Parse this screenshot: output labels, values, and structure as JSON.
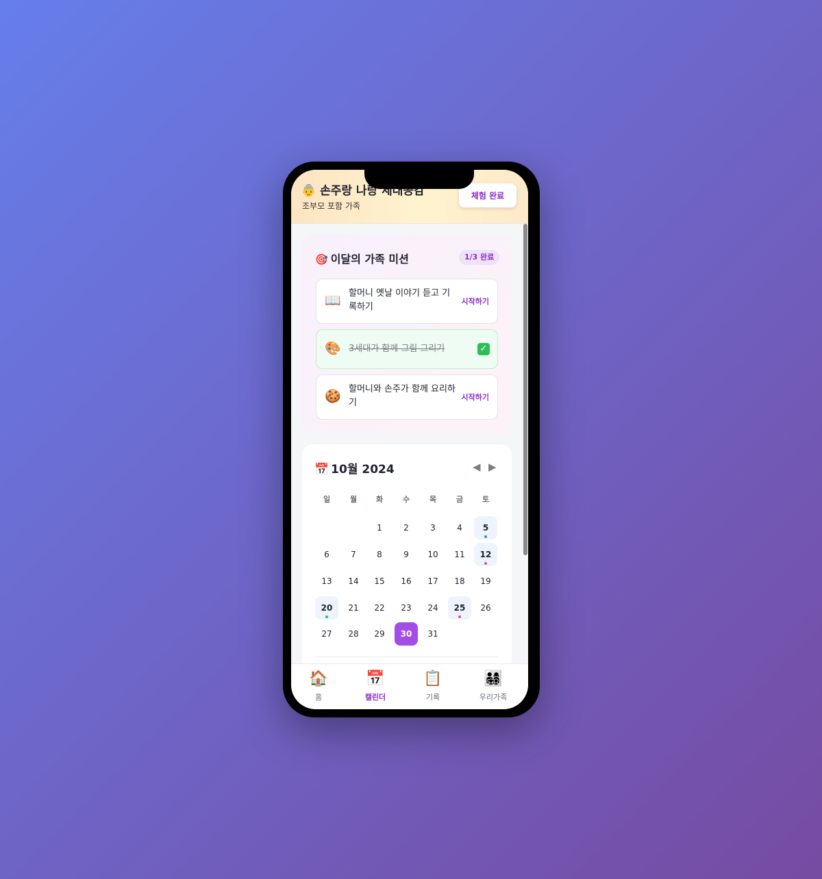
{
  "header": {
    "icon": "👵",
    "title": "손주랑 나랑 세대공감",
    "subtitle": "조부모 포함 가족",
    "done_button": "체험 완료"
  },
  "missions": {
    "icon": "🎯",
    "title": "이달의 가족 미션",
    "progress_badge": "1/3 완료",
    "items": [
      {
        "icon": "📖",
        "text": "할머니 옛날 이야기 듣고 기록하기",
        "action": "시작하기",
        "completed": false
      },
      {
        "icon": "🎨",
        "text": "3세대가 함께 그림 그리기",
        "action": "✓",
        "completed": true
      },
      {
        "icon": "🍪",
        "text": "할머니와 손주가 함께 요리하기",
        "action": "시작하기",
        "completed": false
      }
    ]
  },
  "calendar": {
    "icon": "📅",
    "title": "10월 2024",
    "prev_icon": "◀",
    "next_icon": "▶",
    "weekdays": [
      "일",
      "월",
      "화",
      "수",
      "목",
      "금",
      "토"
    ],
    "first_weekday_index": 2,
    "days_in_month": 31,
    "today": 30,
    "events": [
      {
        "day": 5,
        "color": "#3b82f6"
      },
      {
        "day": 12,
        "color": "#ec4899"
      },
      {
        "day": 20,
        "color": "#22c55e"
      },
      {
        "day": 25,
        "color": "#ec4899"
      }
    ],
    "accent_color": "#a24de6"
  },
  "bottom_nav": {
    "items": [
      {
        "icon": "🏠",
        "label": "홈",
        "active": false
      },
      {
        "icon": "📅",
        "label": "캘린더",
        "active": true
      },
      {
        "icon": "📋",
        "label": "기록",
        "active": false
      },
      {
        "icon": "👨‍👩‍👧‍👦",
        "label": "우리가족",
        "active": false
      }
    ]
  }
}
